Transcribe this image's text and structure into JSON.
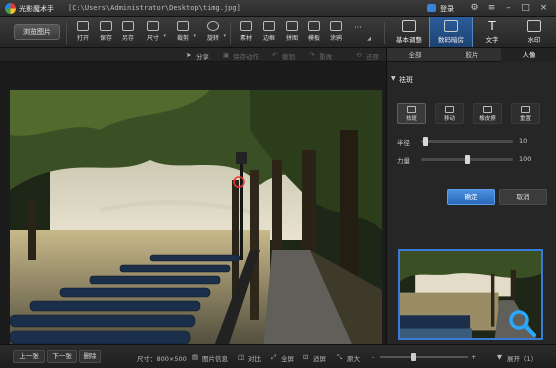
{
  "window": {
    "app_name": "光影魔术手",
    "file_path": "[C:\\Users\\Administrator\\Desktop\\timg.jpg]",
    "login_label": "登录"
  },
  "toolbar": {
    "open_label": "浏览图片",
    "tools": [
      {
        "label": "打开",
        "icon": "folder-icon"
      },
      {
        "label": "保存",
        "icon": "save-icon"
      },
      {
        "label": "另存",
        "icon": "save-as-icon"
      },
      {
        "label": "尺寸",
        "icon": "resize-icon"
      },
      {
        "label": "裁剪",
        "icon": "crop-icon"
      },
      {
        "label": "旋转",
        "icon": "rotate-icon"
      },
      {
        "label": "素材",
        "icon": "material-icon"
      },
      {
        "label": "边框",
        "icon": "border-icon"
      },
      {
        "label": "拼图",
        "icon": "collage-icon"
      },
      {
        "label": "模板",
        "icon": "template-icon"
      },
      {
        "label": "涂鸦",
        "icon": "doodle-icon"
      }
    ],
    "more_label": "···",
    "right_tabs": [
      {
        "label": "基本调整",
        "icon": "adjust-icon"
      },
      {
        "label": "数码暗房",
        "icon": "darkroom-icon"
      },
      {
        "label": "文字",
        "icon": "text-icon"
      },
      {
        "label": "水印",
        "icon": "watermark-icon"
      }
    ]
  },
  "action_bar": {
    "share": "分享",
    "save_action": "保存动作",
    "undo": "撤销",
    "redo": "重做",
    "restore": "还原"
  },
  "panel": {
    "tabs": [
      "全部",
      "胶片",
      "人像"
    ],
    "active_tab": "人像",
    "section_title": "祛斑",
    "tools": [
      {
        "label": "祛斑",
        "icon": "cursor-icon"
      },
      {
        "label": "移动",
        "icon": "move-icon"
      },
      {
        "label": "橡皮擦",
        "icon": "eraser-icon"
      },
      {
        "label": "重置",
        "icon": "reset-icon"
      }
    ],
    "sliders": [
      {
        "label": "半径",
        "value": "10",
        "fraction": 0.04
      },
      {
        "label": "力量",
        "value": "100",
        "fraction": 0.5
      }
    ],
    "ok_label": "确定",
    "cancel_label": "取消"
  },
  "status_bar": {
    "prev": "上一张",
    "next": "下一张",
    "delete": "删除",
    "size": "尺寸：800×500",
    "info": "图片信息",
    "compare": "对比",
    "fullscreen": "全屏",
    "fit": "适屏",
    "original": "原大",
    "zoom_minus": "-",
    "zoom_plus": "+",
    "zoom_fraction": 0.38,
    "expand": "展开（1）"
  },
  "colors": {
    "accent": "#3a7bd5",
    "active_tab": "#2b5d9b",
    "background": "#1e1e1e"
  }
}
